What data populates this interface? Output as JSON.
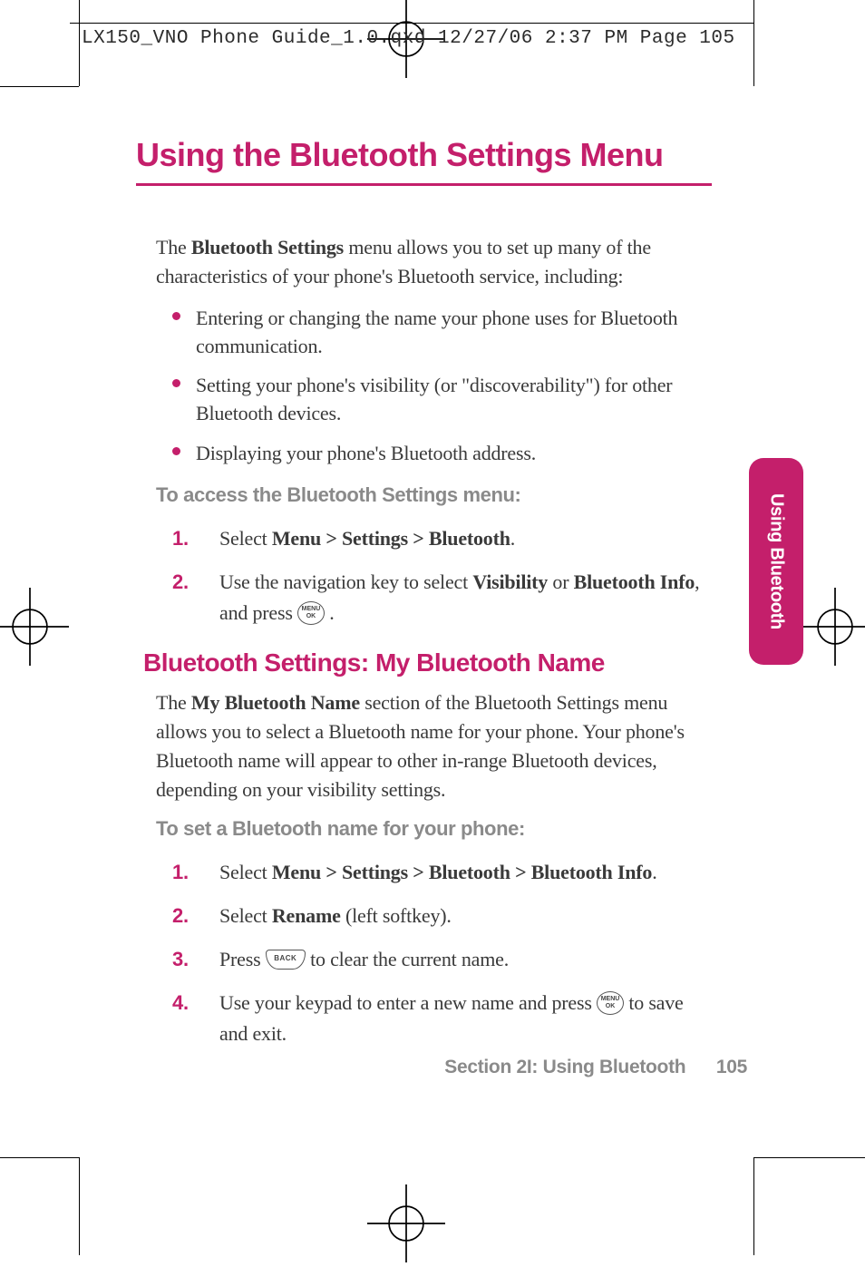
{
  "print_header": "LX150_VNO Phone Guide_1.0.qxd  12/27/06  2:37 PM  Page 105",
  "title": "Using the Bluetooth Settings Menu",
  "intro_pre": "The ",
  "intro_bold": "Bluetooth Settings",
  "intro_post": " menu allows you to set up many of the characteristics of your phone's Bluetooth service, including:",
  "bullets": [
    "Entering or changing the name your phone uses for Bluetooth communication.",
    "Setting your phone's visibility (or \"discoverability\") for other Bluetooth devices.",
    "Displaying your phone's Bluetooth address."
  ],
  "subhead1": "To access the Bluetooth Settings menu:",
  "steps1": {
    "s1_pre": "Select ",
    "s1_bold": "Menu > Settings > Bluetooth",
    "s1_post": ".",
    "s2_pre": "Use the navigation key to select ",
    "s2_b1": "Visibility",
    "s2_mid": " or ",
    "s2_b2": "Bluetooth Info",
    "s2_post1": ", and press ",
    "s2_post2": " ."
  },
  "section2": "Bluetooth Settings: My Bluetooth Name",
  "para2_pre": "The ",
  "para2_bold": "My Bluetooth Name",
  "para2_post": " section of the Bluetooth Settings menu allows you to select a Bluetooth name for your phone. Your phone's Bluetooth name will appear to other in-range Bluetooth devices, depending on your visibility settings.",
  "subhead2": "To set a Bluetooth name for your phone:",
  "steps2": {
    "s1_pre": "Select ",
    "s1_bold": "Menu > Settings > Bluetooth > Bluetooth Info",
    "s1_post": ".",
    "s2_pre": "Select ",
    "s2_bold": "Rename",
    "s2_post": " (left softkey).",
    "s3_pre": "Press ",
    "s3_post": " to clear the current name.",
    "s4_pre": "Use your keypad to enter a new name and press ",
    "s4_post": " to save and exit."
  },
  "key_menuok_l1": "MENU",
  "key_menuok_l2": "OK",
  "key_back": "BACK",
  "sidetab": "Using Bluetooth",
  "footer_section": "Section 2I: Using Bluetooth",
  "footer_page": "105"
}
